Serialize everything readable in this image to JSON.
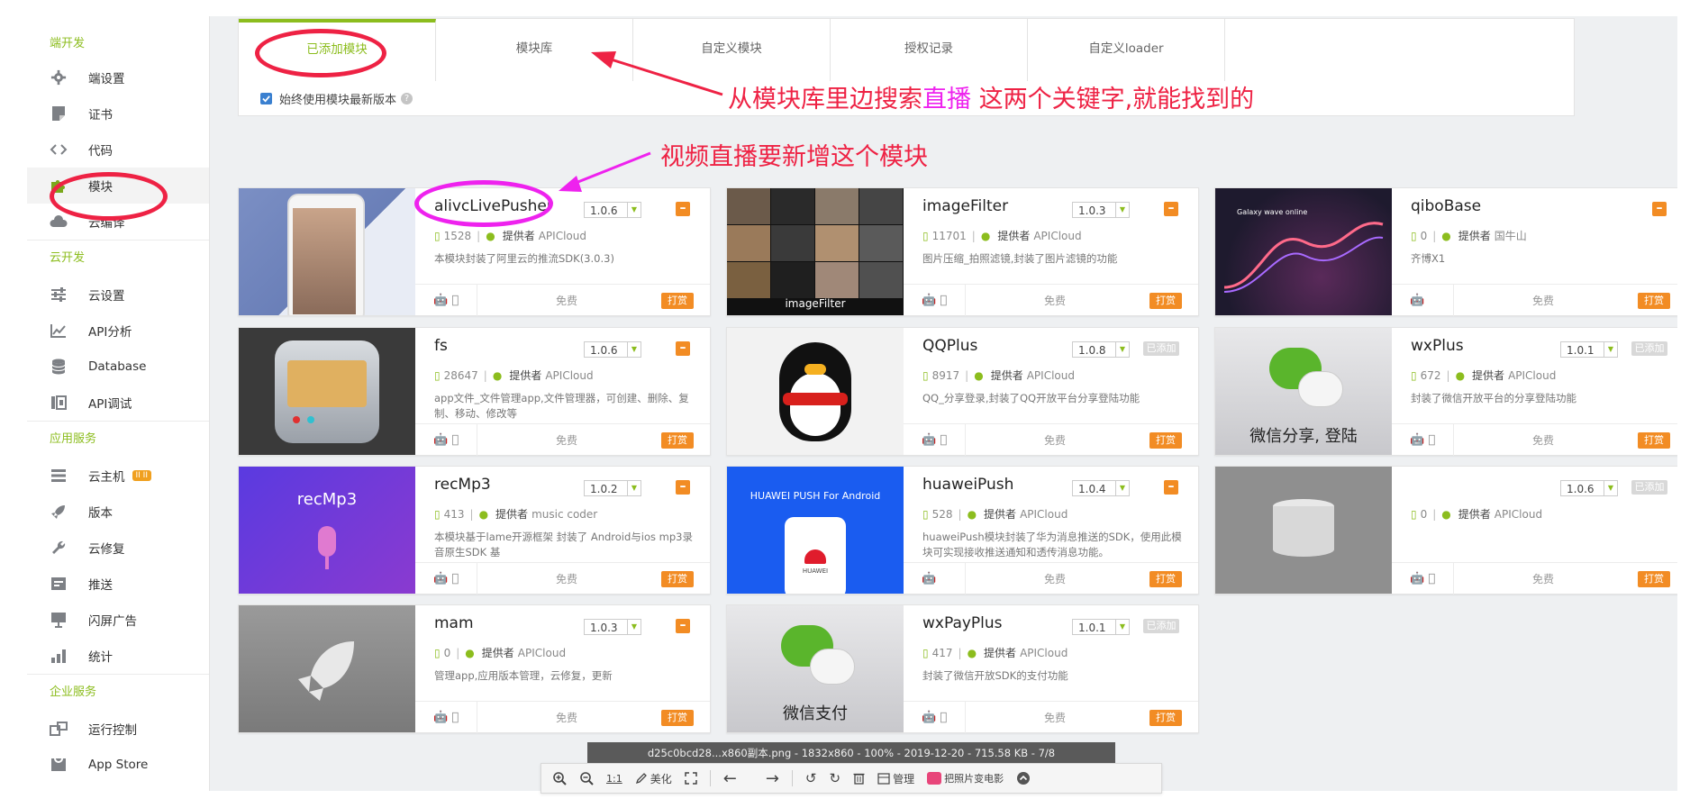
{
  "sidebar": {
    "groups": [
      {
        "title": "端开发",
        "items": [
          {
            "label": "端设置",
            "icon": "gear-icon"
          },
          {
            "label": "证书",
            "icon": "certificate-icon"
          },
          {
            "label": "代码",
            "icon": "code-icon"
          },
          {
            "label": "模块",
            "icon": "puzzle-icon",
            "active": true
          },
          {
            "label": "云编译",
            "icon": "cloud-icon"
          }
        ]
      },
      {
        "title": "云开发",
        "items": [
          {
            "label": "云设置",
            "icon": "sliders-icon"
          },
          {
            "label": "API分析",
            "icon": "chart-line-icon"
          },
          {
            "label": "Database",
            "icon": "database-icon"
          },
          {
            "label": "API调试",
            "icon": "debug-icon"
          }
        ]
      },
      {
        "title": "应用服务",
        "items": [
          {
            "label": "云主机",
            "icon": "server-icon",
            "badge": "II II"
          },
          {
            "label": "版本",
            "icon": "rocket-icon"
          },
          {
            "label": "云修复",
            "icon": "wrench-icon"
          },
          {
            "label": "推送",
            "icon": "push-icon"
          },
          {
            "label": "闪屏广告",
            "icon": "splash-ad-icon"
          },
          {
            "label": "统计",
            "icon": "bar-chart-icon"
          }
        ]
      },
      {
        "title": "企业服务",
        "items": [
          {
            "label": "运行控制",
            "icon": "control-icon"
          },
          {
            "label": "App Store",
            "icon": "store-icon"
          }
        ]
      }
    ]
  },
  "tabs": [
    {
      "label": "已添加模块",
      "active": true
    },
    {
      "label": "模块库"
    },
    {
      "label": "自定义模块"
    },
    {
      "label": "授权记录"
    },
    {
      "label": "自定义loader"
    }
  ],
  "option": {
    "label": "始终使用模块最新版本",
    "checked": true,
    "help": "?"
  },
  "common": {
    "provider_label": "提供者",
    "free_label": "免费",
    "buy_label": "打赏",
    "added_label": "已添加"
  },
  "cards": [
    {
      "name": "alivcLivePusher",
      "version": "1.0.6",
      "status": "remove",
      "downloads": "1528",
      "provider": "APICloud",
      "desc": "本模块封装了阿里云的推流SDK(3.0.3)",
      "platforms": "android-apple",
      "thumb": "phone"
    },
    {
      "name": "imageFilter",
      "version": "1.0.3",
      "status": "remove",
      "downloads": "11701",
      "provider": "APICloud",
      "desc": "图片压缩_拍照滤镜,封装了图片滤镜的功能",
      "platforms": "android-apple",
      "thumb": "filter",
      "thumb_text": "imageFilter"
    },
    {
      "name": "qiboBase",
      "version": "",
      "status": "remove",
      "downloads": "0",
      "provider": "国牛山",
      "desc": "齐博X1",
      "platforms": "android",
      "thumb": "wave",
      "thumb_text": "Galaxy wave online"
    },
    {
      "name": "fs",
      "version": "1.0.6",
      "status": "remove",
      "downloads": "28647",
      "provider": "APICloud",
      "desc": "app文件_文件管理app,文件管理器，可创建、删除、复制、移动、修改等",
      "platforms": "android-apple",
      "thumb": "folder"
    },
    {
      "name": "QQPlus",
      "version": "1.0.8",
      "status": "added",
      "downloads": "8917",
      "provider": "APICloud",
      "desc": "QQ_分享登录,封装了QQ开放平台分享登陆功能",
      "platforms": "android-apple",
      "thumb": "penguin"
    },
    {
      "name": "wxPlus",
      "version": "1.0.1",
      "status": "added",
      "downloads": "672",
      "provider": "APICloud",
      "desc": "封装了微信开放平台的分享登陆功能",
      "platforms": "android-apple",
      "thumb": "wechat",
      "thumb_text": "微信分享, 登陆"
    },
    {
      "name": "recMp3",
      "version": "1.0.2",
      "status": "remove",
      "downloads": "413",
      "provider": "music coder",
      "desc": "本模块基于lame开源框架 封装了 Android与ios mp3录音原生SDK 基",
      "platforms": "android-apple",
      "thumb": "mic",
      "thumb_text": "recMp3"
    },
    {
      "name": "huaweiPush",
      "version": "1.0.4",
      "status": "remove",
      "downloads": "528",
      "provider": "APICloud",
      "desc": "huaweiPush模块封装了华为消息推送的SDK，使用此模块可实现接收推送通知和透传消息功能。",
      "platforms": "android",
      "thumb": "huawei",
      "thumb_text": "HUAWEI PUSH For Android",
      "thumb_sub": "HUAWEI"
    },
    {
      "name": "",
      "version": "1.0.6",
      "status": "added",
      "downloads": "0",
      "provider": "APICloud",
      "desc": "",
      "platforms": "android-apple",
      "thumb": "db"
    },
    {
      "name": "mam",
      "version": "1.0.3",
      "status": "remove",
      "downloads": "0",
      "provider": "APICloud",
      "desc": "管理app,应用版本管理，云修复，更新",
      "platforms": "android-apple",
      "thumb": "rocket"
    },
    {
      "name": "wxPayPlus",
      "version": "1.0.1",
      "status": "added",
      "downloads": "417",
      "provider": "APICloud",
      "desc": "封装了微信开放SDK的支付功能",
      "platforms": "android-apple",
      "thumb": "wechat",
      "thumb_text": "微信支付"
    }
  ],
  "annotations": {
    "search_hint_a": "从模块库里边搜索",
    "search_hint_b": "直播",
    "search_hint_c": " 这两个关键字,就能找到的",
    "add_hint": "视频直播要新增这个模块"
  },
  "viewer": {
    "status": "d25c0bcd28...x860副本.png - 1832x860 - 100% - 2019-12-20 - 715.58 KB - 7/8",
    "ratio": "1:1",
    "beautify": "美化",
    "manage": "管理",
    "video": "把照片变电影"
  },
  "colors": {
    "accent": "#8cbd1e",
    "orange": "#f28c24",
    "annotation_red": "#ee2244",
    "annotation_magenta": "#ee22ee"
  }
}
